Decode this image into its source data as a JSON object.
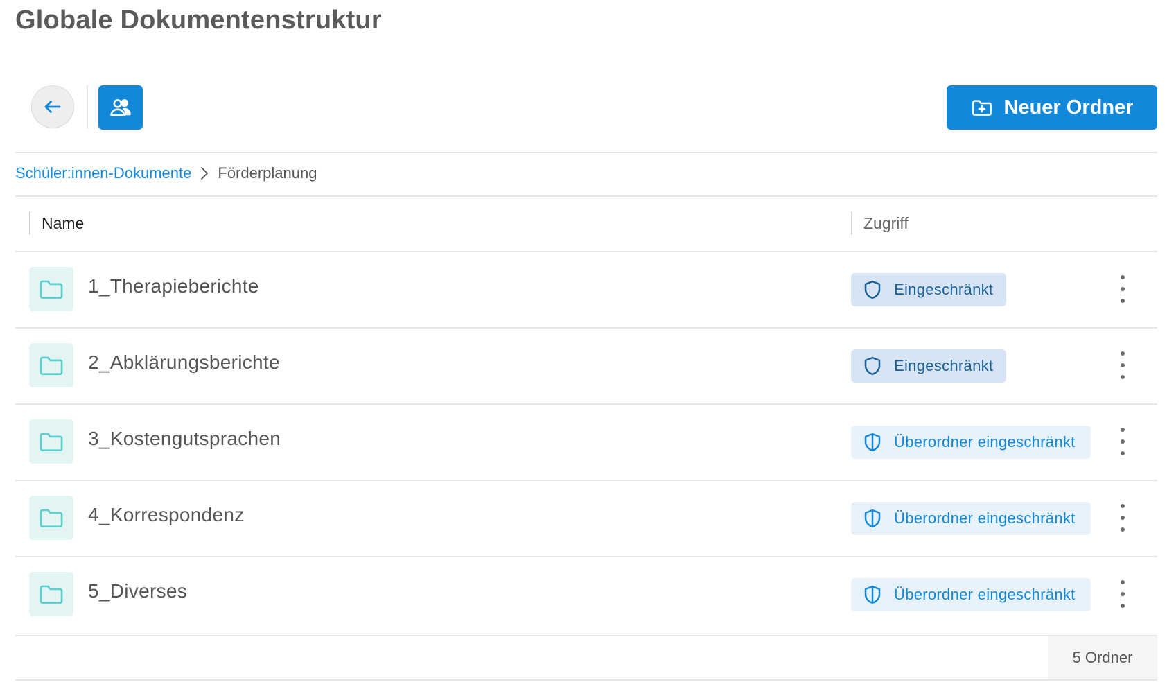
{
  "page": {
    "title": "Globale Dokumentenstruktur"
  },
  "toolbar": {
    "back_icon": "arrow-left-icon",
    "users_icon": "users-icon",
    "new_folder_label": "Neuer Ordner",
    "new_folder_icon": "folder-plus-icon"
  },
  "breadcrumb": {
    "parent": "Schüler:innen-Dokumente",
    "current": "Förderplanung"
  },
  "table": {
    "columns": {
      "name": "Name",
      "access": "Zugriff"
    },
    "rows": [
      {
        "name": "1_Therapieberichte",
        "access": "Eingeschränkt",
        "access_type": "restricted"
      },
      {
        "name": "2_Abklärungsberichte",
        "access": "Eingeschränkt",
        "access_type": "restricted"
      },
      {
        "name": "3_Kostengutsprachen",
        "access": "Überordner eingeschränkt",
        "access_type": "parent"
      },
      {
        "name": "4_Korrespondenz",
        "access": "Überordner eingeschränkt",
        "access_type": "parent"
      },
      {
        "name": "5_Diverses",
        "access": "Überordner eingeschränkt",
        "access_type": "parent"
      }
    ]
  },
  "footer": {
    "count": "5 Ordner"
  },
  "colors": {
    "accent": "#1488d8",
    "folder_tile": "#e2f5f3",
    "folder_icon": "#5ccfcf",
    "badge_restricted_bg": "#d6e4f3",
    "badge_parent_bg": "#e8f2fb"
  }
}
